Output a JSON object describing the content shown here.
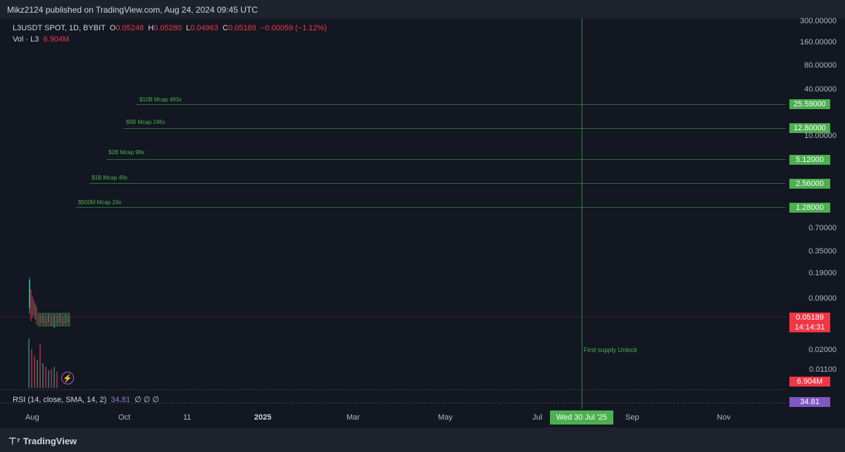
{
  "header": {
    "publisher_text": "Mikz2124 published on TradingView.com, Aug 24, 2024 09:45 UTC"
  },
  "legend": {
    "symbol": "L3USDT SPOT, 1D, BYBIT",
    "o_label": "O",
    "o_value": "0.05248",
    "h_label": "H",
    "h_value": "0.05280",
    "l_label": "L",
    "l_value": "0.04963",
    "c_label": "C",
    "c_value": "0.05189",
    "change": "−0.00059 (−1.12%)",
    "vol_label": "Vol · L3",
    "vol_value": "6.904M"
  },
  "levels": [
    {
      "label": "$10B Mcap 493x",
      "price": "25.59000"
    },
    {
      "label": "$5B Mcap 246x",
      "price": "12.80000"
    },
    {
      "label": "$2B Mcap 98x",
      "price": "5.12000"
    },
    {
      "label": "$1B Mcap 49x",
      "price": "2.56000"
    },
    {
      "label": "$500M Mcap 24x",
      "price": "1.28000"
    }
  ],
  "price_axis": [
    "300.00000",
    "160.00000",
    "80.00000",
    "40.00000",
    "10.00000",
    "0.70000",
    "0.35000",
    "0.19000",
    "0.09000",
    "0.02000",
    "0.01100"
  ],
  "current_price": "0.05189",
  "countdown": "14:14:31",
  "volume_badge": "6.904M",
  "rsi": {
    "label": "RSI (14, close, SMA, 14, 2)",
    "value": "34.81",
    "extras": "∅ ∅ ∅",
    "badge": "34.81"
  },
  "date_axis": [
    "Aug",
    "Oct",
    "11",
    "2025",
    "Mar",
    "May",
    "Jul",
    "Sep",
    "Nov"
  ],
  "selected_date": "Wed 30 Jul '25",
  "annotation": "First supply Unlock",
  "footer": {
    "brand": "TradingView"
  },
  "colors": {
    "accent_green": "#4caf50",
    "down_red": "#f23645",
    "rsi_purple": "#7e57c2"
  }
}
